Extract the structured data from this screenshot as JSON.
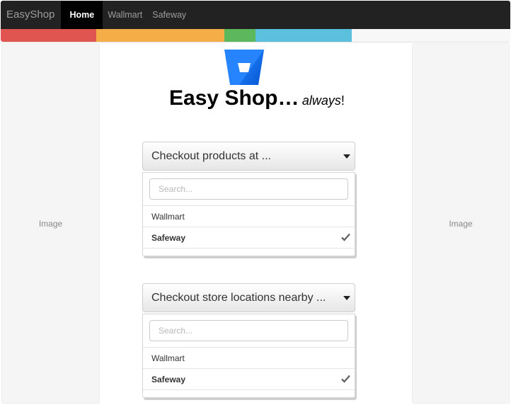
{
  "navbar": {
    "brand": "EasyShop",
    "items": [
      {
        "label": "Home",
        "active": true
      },
      {
        "label": "Wallmart",
        "active": false
      },
      {
        "label": "Safeway",
        "active": false
      }
    ]
  },
  "strip_colors": [
    "#e05550",
    "#f4ad47",
    "#5cb85c",
    "#5bc0de",
    "#f7f7f7"
  ],
  "side_images": {
    "left_label": "Image",
    "right_label": "Image"
  },
  "logo": {
    "icon": "bitbucket-icon",
    "color": "#2684ff"
  },
  "title": {
    "main": "Easy Shop",
    "ellipsis": "…",
    "tagline": "always",
    "bang": "!"
  },
  "dropdown_products": {
    "label": "Checkout products at ...",
    "search_placeholder": "Search...",
    "options": [
      {
        "label": "Wallmart",
        "selected": false
      },
      {
        "label": "Safeway",
        "selected": true
      }
    ]
  },
  "dropdown_locations": {
    "label": "Checkout store locations nearby ...",
    "search_placeholder": "Search...",
    "options": [
      {
        "label": "Wallmart",
        "selected": false
      },
      {
        "label": "Safeway",
        "selected": true
      }
    ]
  }
}
